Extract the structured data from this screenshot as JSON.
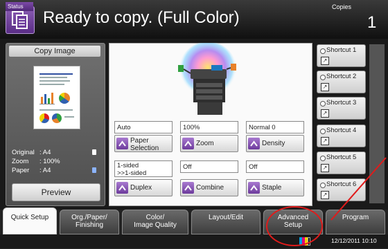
{
  "header": {
    "title": "Ready to copy. (Full Color)",
    "copies_label": "Copies",
    "copies_count": "1"
  },
  "left_panel": {
    "copy_image_label": "Copy Image",
    "status": [
      {
        "label": "Original",
        "value": ": A4"
      },
      {
        "label": "Zoom",
        "value": ": 100%"
      },
      {
        "label": "Paper",
        "value": ": A4"
      }
    ],
    "preview_label": "Preview"
  },
  "settings": {
    "row1": [
      {
        "value": "Auto",
        "button": "Paper\nSelection"
      },
      {
        "value": "100%",
        "button": "Zoom"
      },
      {
        "value": "Normal 0",
        "button": "Density"
      }
    ],
    "row2": [
      {
        "value": "1-sided\n>>1-sided",
        "button": "Duplex"
      },
      {
        "value": "Off",
        "button": "Combine"
      },
      {
        "value": "Off",
        "button": "Staple"
      }
    ]
  },
  "shortcuts": [
    "Shortcut 1",
    "Shortcut 2",
    "Shortcut 3",
    "Shortcut 4",
    "Shortcut 5",
    "Shortcut 6"
  ],
  "tabs": [
    {
      "label": "Quick Setup",
      "active": true
    },
    {
      "label": "Org./Paper/\nFinishing",
      "active": false
    },
    {
      "label": "Color/\nImage Quality",
      "active": false
    },
    {
      "label": "Layout/Edit",
      "active": false
    },
    {
      "label": "Advanced\nSetup",
      "active": false
    },
    {
      "label": "Program",
      "active": false
    }
  ],
  "status_bar": {
    "status_label": "Status",
    "datetime": "12/12/2011  10:10"
  },
  "colors": {
    "accent_purple": "#6d3b9c",
    "annotation_red": "#e01b1b",
    "toner": [
      "#00a0e0",
      "#e0007a",
      "#f0d000",
      "#111111"
    ]
  },
  "icons": [
    "copy-mode-icon",
    "document-icon",
    "shortcut-icon",
    "chevron-up-icon",
    "toner-icon"
  ]
}
